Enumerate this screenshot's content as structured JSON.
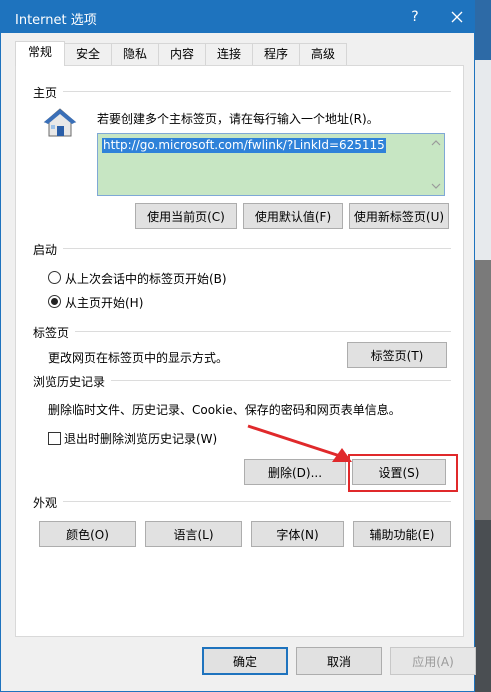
{
  "window": {
    "title": "Internet 选项",
    "help_glyph": "?",
    "close_icon": "close-icon",
    "title_color": "#1e73be"
  },
  "tabs": [
    {
      "label": "常规",
      "active": true
    },
    {
      "label": "安全"
    },
    {
      "label": "隐私"
    },
    {
      "label": "内容"
    },
    {
      "label": "连接"
    },
    {
      "label": "程序"
    },
    {
      "label": "高级"
    }
  ],
  "homepage": {
    "section_title": "主页",
    "instruction": "若要创建多个主标签页，请在每行输入一个地址(R)。",
    "url": "http://go.microsoft.com/fwlink/?LinkId=625115",
    "buttons": {
      "use_current": "使用当前页(C)",
      "use_default": "使用默认值(F)",
      "use_new_tab": "使用新标签页(U)"
    }
  },
  "startup": {
    "section_title": "启动",
    "options": [
      {
        "label": "从上次会话中的标签页开始(B)",
        "selected": false
      },
      {
        "label": "从主页开始(H)",
        "selected": true
      }
    ]
  },
  "tabs_section": {
    "section_title": "标签页",
    "description": "更改网页在标签页中的显示方式。",
    "button": "标签页(T)"
  },
  "history": {
    "section_title": "浏览历史记录",
    "description": "删除临时文件、历史记录、Cookie、保存的密码和网页表单信息。",
    "delete_on_exit_label": "退出时删除浏览历史记录(W)",
    "delete_on_exit_checked": false,
    "delete_button": "删除(D)...",
    "settings_button": "设置(S)"
  },
  "appearance": {
    "section_title": "外观",
    "buttons": {
      "colors": "颜色(O)",
      "languages": "语言(L)",
      "fonts": "字体(N)",
      "accessibility": "辅助功能(E)"
    }
  },
  "footer": {
    "ok": "确定",
    "cancel": "取消",
    "apply": "应用(A)"
  },
  "annotation": {
    "highlight_color": "#e0292b"
  }
}
